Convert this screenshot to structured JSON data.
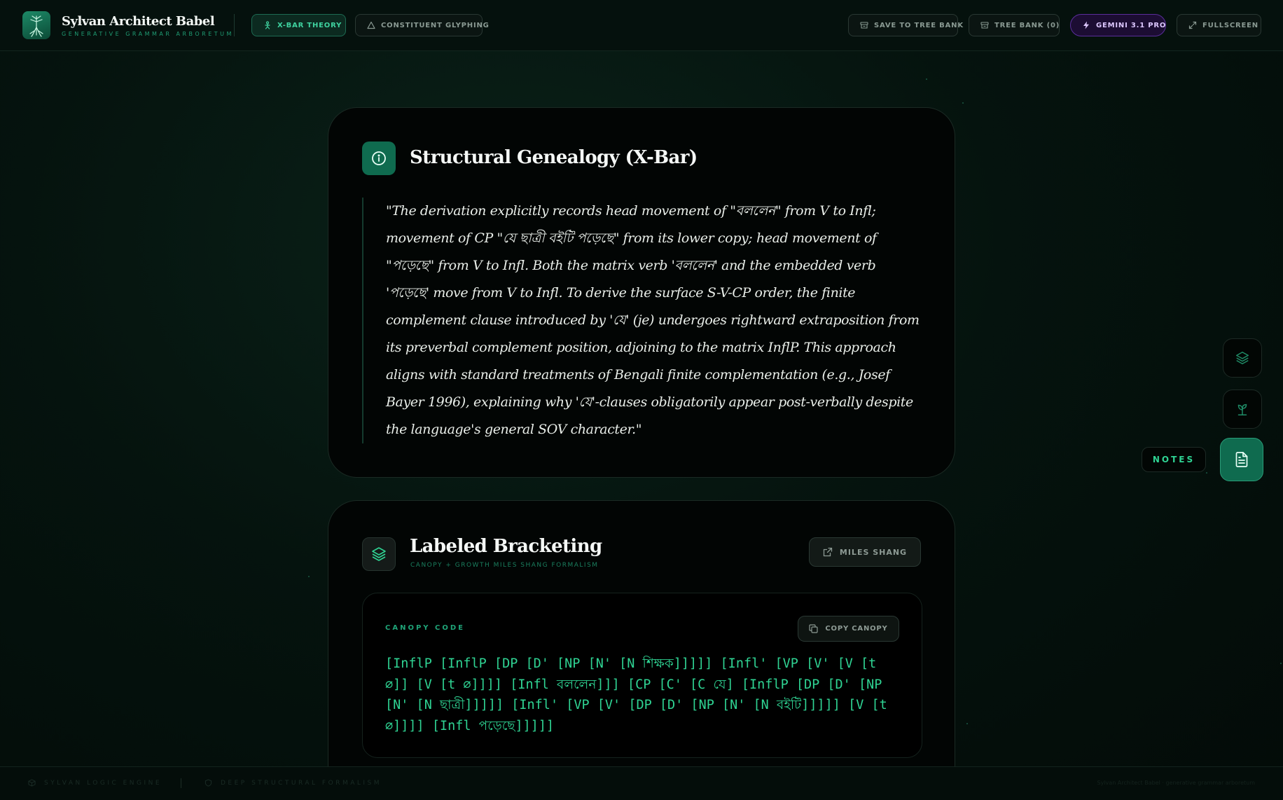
{
  "header": {
    "title": "Sylvan Architect Babel",
    "subtitle": "GENERATIVE GRAMMAR ARBORETUM",
    "tabs": [
      {
        "label": "X-BAR THEORY",
        "icon": "person-tree-icon",
        "active": true
      },
      {
        "label": "CONSTITUENT GLYPHING",
        "icon": "triangle-icon",
        "active": false
      }
    ],
    "actions": [
      {
        "label": "SAVE TO TREE BANK",
        "icon": "archive-icon"
      },
      {
        "label": "TREE BANK (0)",
        "icon": "archive-icon"
      },
      {
        "label": "GEMINI 3.1 PRO",
        "icon": "bolt-icon"
      },
      {
        "label": "FULLSCREEN",
        "icon": "expand-icon"
      }
    ]
  },
  "genealogy": {
    "title": "Structural Genealogy (X-Bar)",
    "icon": "info-icon",
    "quote": "\"The derivation explicitly records head movement of \"বললেন\" from V to Infl; movement of CP \"যে ছাত্রী বইটি পড়েছে\" from its lower copy; head movement of \"পড়েছে\" from V to Infl. Both the matrix verb 'বললেন' and the embedded verb 'পড়েছে' move from V to Infl. To derive the surface S-V-CP order, the finite complement clause introduced by 'যে' (je) undergoes rightward extraposition from its preverbal complement position, adjoining to the matrix InflP. This approach aligns with standard treatments of Bengali finite complementation (e.g., Josef Bayer 1996), explaining why 'যে'-clauses obligatorily appear post-verbally despite the language's general SOV character.\""
  },
  "bracketing": {
    "title": "Labeled Bracketing",
    "subtitle": "CANOPY + GROWTH MILES SHANG FORMALISM",
    "icon": "layers-icon",
    "link_label": "MILES SHANG",
    "canopy_label": "CANOPY CODE",
    "copy_label": "COPY CANOPY",
    "code": "[InflP [InflP [DP [D' [NP [N' [N শিক্ষক]]]]] [Infl' [VP [V' [V [t ∅]] [V [t ∅]]]] [Infl বললেন]]] [CP [C' [C যে] [InflP [DP [D' [NP [N' [N ছাত্রী]]]]] [Infl' [VP [V' [DP [D' [NP [N' [N বইটি]]]]] [V [t ∅]]]] [Infl পড়েছে]]]]]"
  },
  "tools": {
    "notes_label": "NOTES",
    "items": [
      "layers-icon",
      "plant-icon",
      "notes-icon"
    ]
  },
  "footer": {
    "left": "SYLVAN LOGIC ENGINE",
    "middle": "DEEP STRUCTURAL FORMALISM",
    "right": "Sylvan Architect Babel · generative grammar arboretum"
  },
  "colors": {
    "accent": "#2fd393",
    "accent_dark": "#0f6b4f",
    "purple": "#5b2e9c",
    "background": "#030b08"
  }
}
